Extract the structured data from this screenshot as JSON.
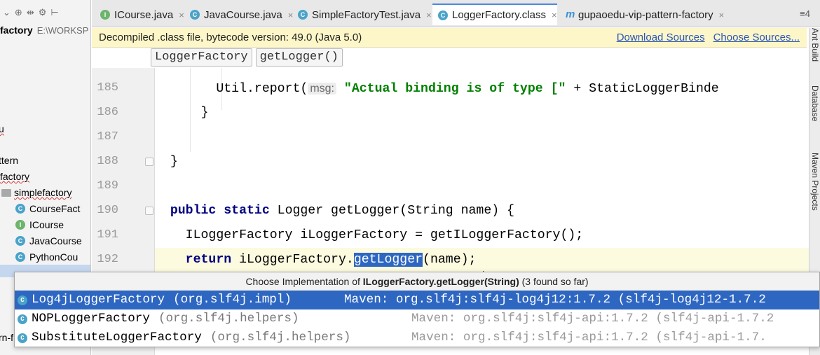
{
  "project": {
    "root_name": "factory",
    "root_path": "E:\\WORKSP",
    "tree": [
      {
        "label": "u",
        "kind": "text",
        "underline": true
      },
      {
        "label": "ttern",
        "kind": "text",
        "underline": false
      },
      {
        "label": "factory",
        "kind": "text",
        "underline": true
      },
      {
        "label": "simplefactory",
        "kind": "folder",
        "underline": true
      },
      {
        "label": "CourseFact",
        "kind": "class"
      },
      {
        "label": "ICourse",
        "kind": "interface"
      },
      {
        "label": "JavaCourse",
        "kind": "class"
      },
      {
        "label": "PythonCou",
        "kind": "class"
      },
      {
        "label": "rn-f",
        "kind": "text"
      }
    ]
  },
  "tabs": [
    {
      "label": "ICourse.java",
      "icon": "interface-icon",
      "active": false
    },
    {
      "label": "JavaCourse.java",
      "icon": "class-icon",
      "active": false
    },
    {
      "label": "SimpleFactoryTest.java",
      "icon": "class-icon",
      "active": false
    },
    {
      "label": "LoggerFactory.class",
      "icon": "class-file-icon",
      "active": true
    },
    {
      "label": "gupaoedu-vip-pattern-factory",
      "icon": "module-icon",
      "active": false
    }
  ],
  "tab_overflow": "≡4",
  "banner": {
    "message": "Decompiled .class file, bytecode version: 49.0 (Java 5.0)",
    "download_sources": "Download Sources",
    "choose_sources": "Choose Sources..."
  },
  "breadcrumbs": [
    "LoggerFactory",
    "getLogger()"
  ],
  "editor": {
    "lines": [
      {
        "no": "185",
        "indent": "        ",
        "code": "Util.report(",
        "hint": "msg:",
        "rest": " ",
        "str": "\"Actual binding is of type [\"",
        "tail": " + StaticLoggerBinde"
      },
      {
        "no": "186",
        "indent": "      ",
        "code": "}"
      },
      {
        "no": "187",
        "indent": "",
        "code": ""
      },
      {
        "no": "188",
        "indent": "  ",
        "code": "}"
      },
      {
        "no": "189",
        "indent": "",
        "code": ""
      },
      {
        "no": "190",
        "indent": "  ",
        "kw": "public static",
        "code": " Logger getLogger(String name) {"
      },
      {
        "no": "191",
        "indent": "    ",
        "code": "ILoggerFactory iLoggerFactory = getILoggerFactory();"
      },
      {
        "no": "192",
        "indent": "    ",
        "kw": "return",
        "code": " iLoggerFactory.",
        "sel": "getLogger",
        "tail": "(name);"
      }
    ]
  },
  "right_tools": [
    "Ant Build",
    "Database",
    "Maven Projects"
  ],
  "popup": {
    "title_prefix": "Choose Implementation of ",
    "title_method": "ILoggerFactory.getLogger(String)",
    "title_suffix": " (3 found so far)",
    "items": [
      {
        "name": "Log4jLoggerFactory",
        "pkg": "(org.slf4j.impl)",
        "maven": "Maven: org.slf4j:slf4j-log4j12:1.7.2 (slf4j-log4j12-1.7.2",
        "selected": true
      },
      {
        "name": "NOPLoggerFactory",
        "pkg": "(org.slf4j.helpers)",
        "maven": "Maven: org.slf4j:slf4j-api:1.7.2 (slf4j-api-1.7.2",
        "selected": false
      },
      {
        "name": "SubstituteLoggerFactory",
        "pkg": "(org.slf4j.helpers)",
        "maven": "Maven: org.slf4j:slf4j-api:1.7.2 (slf4j-api-1.7.",
        "selected": false
      }
    ]
  },
  "colors": {
    "accent": "#2e67c2",
    "keyword": "#000080",
    "string": "#008000",
    "banner_bg": "#fdf6c8",
    "link": "#2c55b8"
  }
}
